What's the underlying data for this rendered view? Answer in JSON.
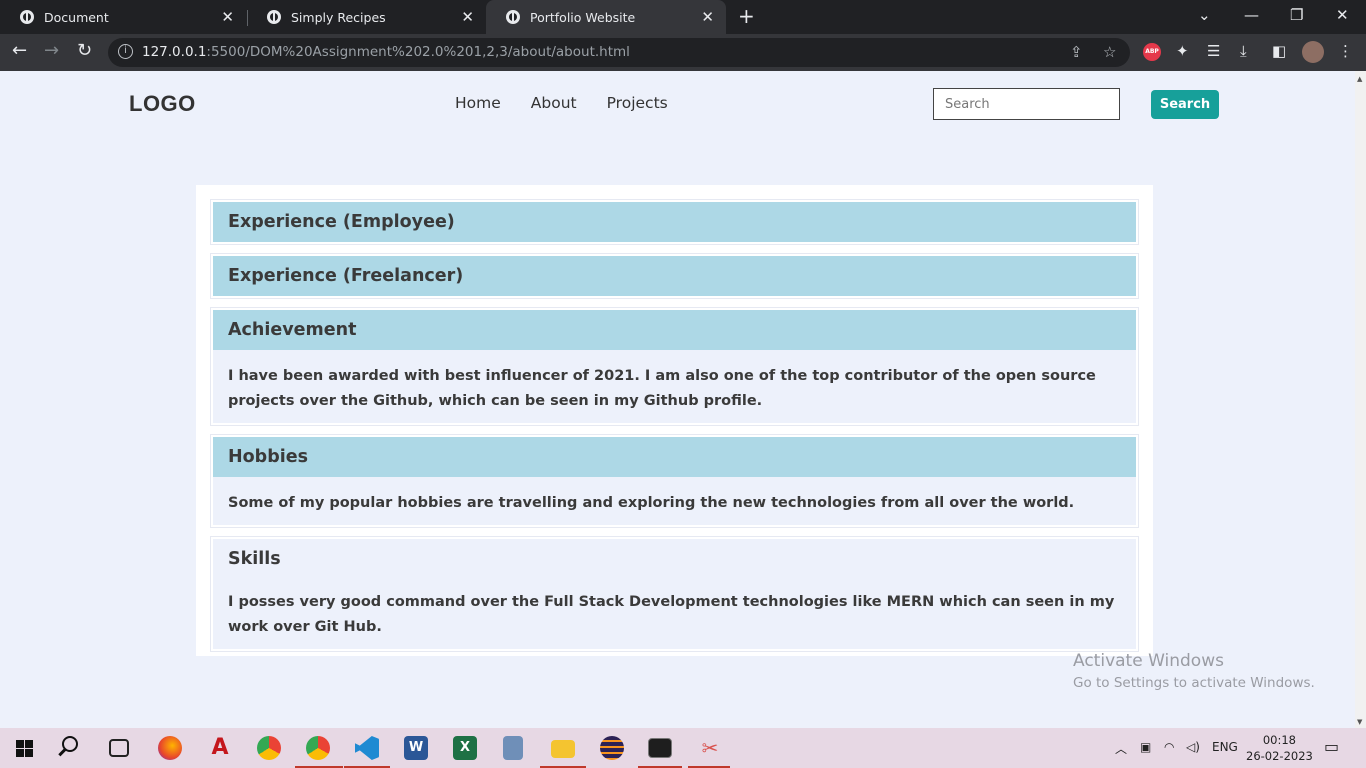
{
  "browser": {
    "tabs": [
      {
        "title": "Document",
        "active": false
      },
      {
        "title": "Simply Recipes",
        "active": false
      },
      {
        "title": "Portfolio Website",
        "active": true
      }
    ],
    "url_host": "127.0.0.1",
    "url_rest": ":5500/DOM%20Assignment%202.0%201,2,3/about/about.html",
    "abp_label": "ABP"
  },
  "header": {
    "logo": "LOGO",
    "nav": [
      "Home",
      "About",
      "Projects"
    ],
    "search_placeholder": "Search",
    "search_button": "Search"
  },
  "sections": [
    {
      "title": "Experience (Employee)",
      "expanded": false,
      "body": ""
    },
    {
      "title": "Experience (Freelancer)",
      "expanded": false,
      "body": ""
    },
    {
      "title": "Achievement",
      "expanded": true,
      "body": "I have been awarded with best influencer of 2021. I am also one of the top contributor of the open source projects over the Github, which can be seen in my Github profile."
    },
    {
      "title": "Hobbies",
      "expanded": true,
      "body": "Some of my popular hobbies are travelling and exploring the new technologies from all over the world."
    },
    {
      "title": "Skills",
      "expanded": true,
      "body": "I posses very good command over the Full Stack Development technologies like MERN which can seen in my work over Git Hub."
    }
  ],
  "watermark": {
    "line1": "Activate Windows",
    "line2": "Go to Settings to activate Windows."
  },
  "taskbar": {
    "language": "ENG",
    "time": "00:18",
    "date": "26-02-2023",
    "apps": [
      "start-icon",
      "search-icon",
      "task-view-icon",
      "firefox-icon",
      "acrobat-icon",
      "chrome-icon",
      "chrome-profile-icon",
      "vscode-icon",
      "word-icon",
      "excel-icon",
      "calculator-icon",
      "file-explorer-icon",
      "eclipse-icon",
      "terminal-icon",
      "snipping-tool-icon"
    ]
  },
  "colors": {
    "accent": "#17a09a",
    "section_header": "#add8e6",
    "page_bg": "#edf1fb"
  }
}
